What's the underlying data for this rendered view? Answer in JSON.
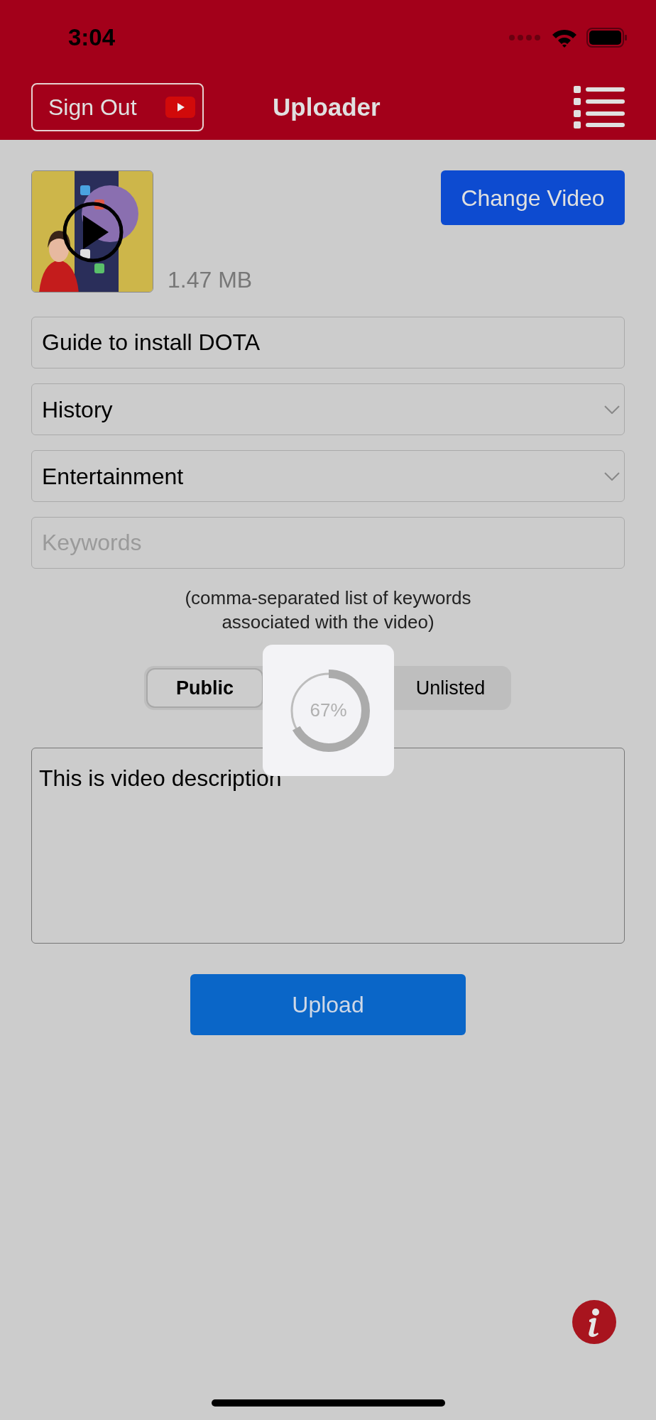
{
  "status_bar": {
    "time": "3:04"
  },
  "header": {
    "sign_out": "Sign Out",
    "title": "Uploader"
  },
  "video": {
    "size": "1.47 MB",
    "change_button": "Change Video"
  },
  "fields": [
    {
      "kind": "text",
      "value": "Guide to install DOTA"
    },
    {
      "kind": "select",
      "value": "History"
    },
    {
      "kind": "select",
      "value": "Entertainment"
    },
    {
      "kind": "text",
      "placeholder": "Keywords"
    }
  ],
  "keywords_hint": "(comma-separated list of keywords\nassociated with the video)",
  "privacy": [
    {
      "label": "Public",
      "selected": true
    },
    {
      "label": "Unlisted",
      "selected": false
    }
  ],
  "upload_progress": {
    "label": "67%",
    "level": 0.67
  },
  "description": "This is video description",
  "upload_button": "Upload"
}
